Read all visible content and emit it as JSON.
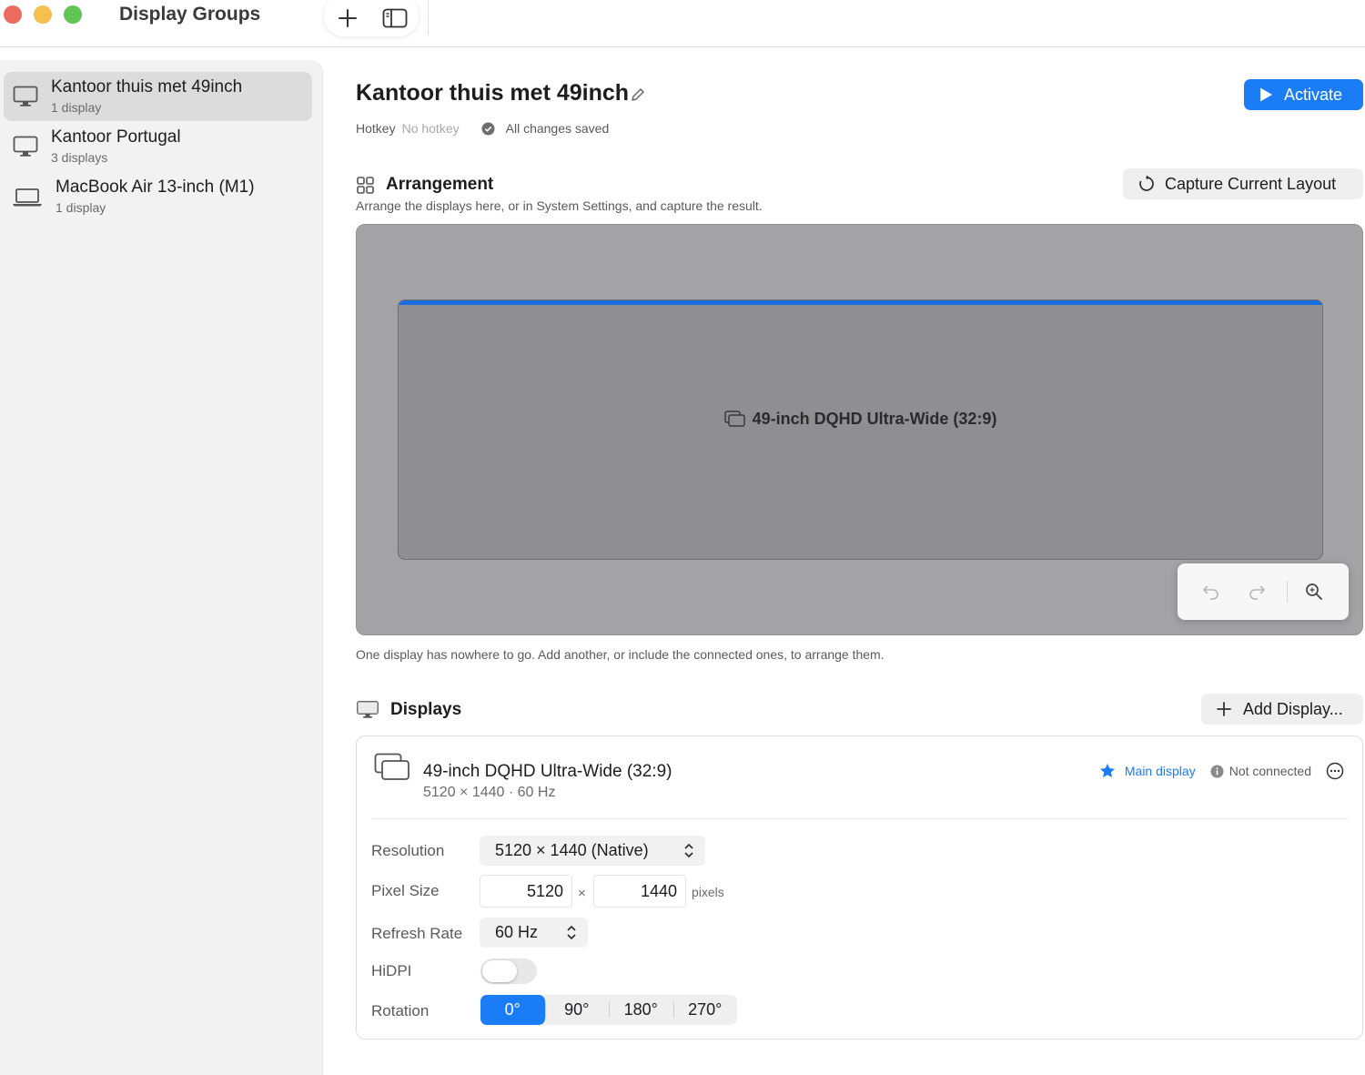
{
  "window": {
    "title": "Display Groups"
  },
  "sidebar": {
    "items": [
      {
        "name": "Kantoor thuis met 49inch",
        "subtitle": "1 display",
        "icon": "desktop-monitor-icon",
        "selected": true
      },
      {
        "name": "Kantoor Portugal",
        "subtitle": "3 displays",
        "icon": "desktop-monitor-icon",
        "selected": false
      },
      {
        "name": "MacBook Air 13-inch (M1)",
        "subtitle": "1 display",
        "icon": "laptop-icon",
        "selected": false
      }
    ]
  },
  "header": {
    "title": "Kantoor thuis met 49inch",
    "activate_label": "Activate",
    "hotkey_label": "Hotkey",
    "hotkey_value": "No hotkey",
    "save_status": "All changes saved"
  },
  "arrangement": {
    "title": "Arrangement",
    "description": "Arrange the displays here, or in System Settings, and capture the result.",
    "capture_label": "Capture Current Layout",
    "display_label": "49-inch DQHD Ultra-Wide (32:9)",
    "note": "One display has nowhere to go. Add another, or include the connected ones, to arrange them."
  },
  "displays": {
    "title": "Displays",
    "add_label": "Add Display...",
    "card": {
      "name": "49-inch DQHD Ultra-Wide (32:9)",
      "specs": "5120 × 1440 · 60 Hz",
      "main_label": "Main display",
      "connection_status": "Not connected",
      "resolution_label": "Resolution",
      "resolution_value": "5120 × 1440 (Native)",
      "pixel_size_label": "Pixel Size",
      "pixel_width": "5120",
      "pixel_height": "1440",
      "times_symbol": "×",
      "pixels_unit": "pixels",
      "refresh_label": "Refresh Rate",
      "refresh_value": "60 Hz",
      "hidpi_label": "HiDPI",
      "hidpi_enabled": false,
      "rotation_label": "Rotation",
      "rotation_options": [
        "0°",
        "90°",
        "180°",
        "270°"
      ],
      "rotation_selected": "0°"
    }
  },
  "colors": {
    "accent": "#1a7df5",
    "canvas_bg": "#a3a2a4",
    "display_fill": "#8f8e90",
    "sidebar_bg": "#f2f2f2",
    "selected_row": "#dcdcdc"
  }
}
